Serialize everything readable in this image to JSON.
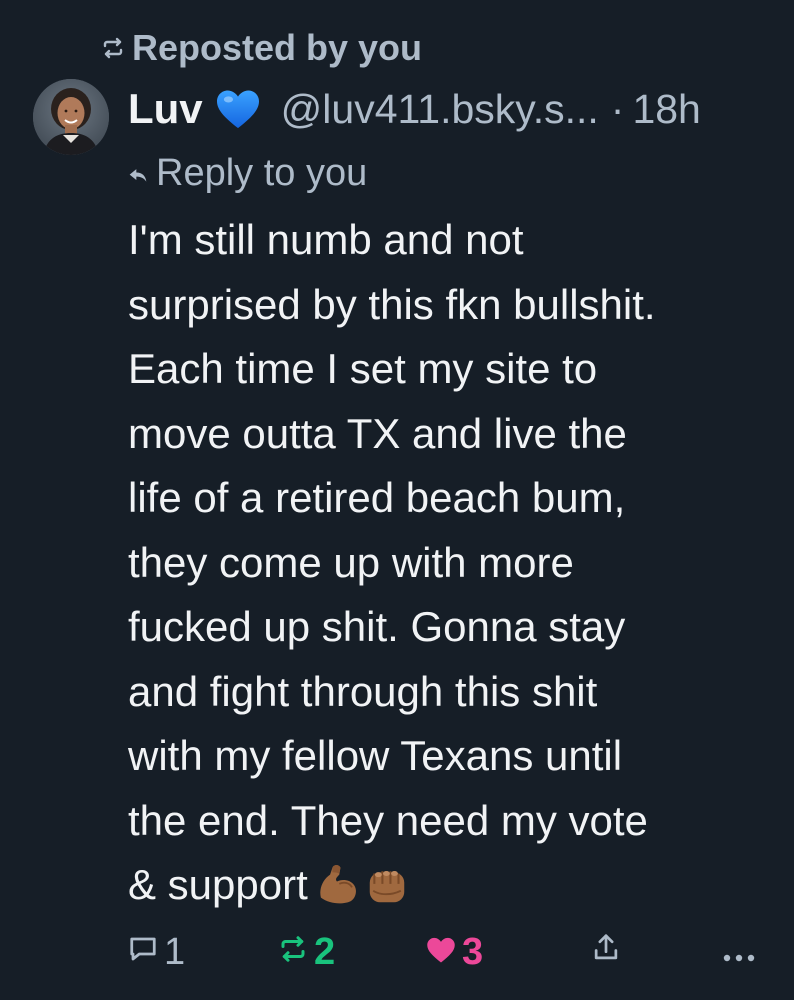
{
  "repost": {
    "label": "Reposted by you",
    "icon": "repost-icon"
  },
  "author": {
    "name": "Luv",
    "badge_emoji": "blue-heart",
    "badge_color": "#1d8cf8",
    "handle": "@luv411.bsky.s...",
    "separator": "·",
    "time": "18h",
    "avatar": "profile-photo"
  },
  "reply": {
    "label": "Reply to you",
    "icon": "reply-arrow-icon"
  },
  "post": {
    "lines": [
      "I'm still numb and not",
      "surprised by this fkn bullshit.",
      "Each time I set my site to",
      "move outta TX and live the",
      "life of a retired beach bum,",
      "they come up with more",
      "fucked up shit. Gonna stay",
      "and fight through this shit",
      "with my fellow Texans until",
      "the end. They need my vote",
      "& support"
    ],
    "emojis": [
      "flexed-biceps",
      "oncoming-fist"
    ]
  },
  "actions": {
    "reply_count": "1",
    "repost_count": "2",
    "like_count": "3",
    "repost_color": "#19c37d",
    "like_color": "#ec4899",
    "muted_color": "#aebbc9"
  },
  "theme": {
    "background": "#161e27",
    "text": "#f1f3f5",
    "muted": "#aebbc9"
  }
}
